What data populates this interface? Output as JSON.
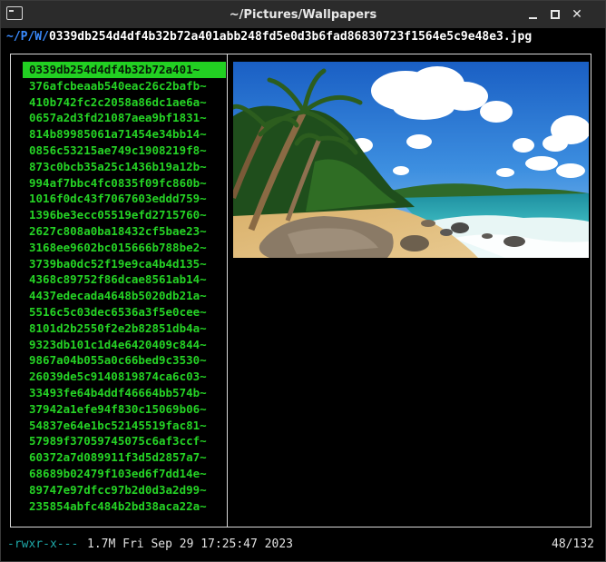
{
  "window": {
    "title": "~/Pictures/Wallpapers"
  },
  "path": {
    "dir": "~/P/W/",
    "file": "0339db254d4df4b32b72a401abb248fd5e0d3b6fad86830723f1564e5c9e48e3.jpg"
  },
  "file_list": [
    "0339db254d4df4b32b72a401~",
    "376afcbeaab540eac26c2bafb~",
    "410b742fc2c2058a86dc1ae6a~",
    "0657a2d3fd21087aea9bf1831~",
    "814b89985061a71454e34bb14~",
    "0856c53215ae749c1908219f8~",
    "873c0bcb35a25c1436b19a12b~",
    "994af7bbc4fc0835f09fc860b~",
    "1016f0dc43f7067603eddd759~",
    "1396be3ecc05519efd2715760~",
    "2627c808a0ba18432cf5bae23~",
    "3168ee9602bc015666b788be2~",
    "3739ba0dc52f19e9ca4b4d135~",
    "4368c89752f86dcae8561ab14~",
    "4437edecada4648b5020db21a~",
    "5516c5c03dec6536a3f5e0cee~",
    "8101d2b2550f2e2b82851db4a~",
    "9323db101c1d4e6420409c844~",
    "9867a04b055a0c66bed9c3530~",
    "26039de5c9140819874ca6c03~",
    "33493fe64b4ddf46664bb574b~",
    "37942a1efe94f830c15069b06~",
    "54837e64e1bc52145519fac81~",
    "57989f37059745075c6af3ccf~",
    "60372a7d089911f3d5d2857a7~",
    "68689b02479f103ed6f7dd14e~",
    "89747e97dfcc97b2d0d3a2d99~",
    "235854abfc484b2bd38aca22a~"
  ],
  "selected_index": 0,
  "status": {
    "permissions": "-rwxr-x---",
    "meta": "1.7M Fri Sep 29 17:25:47 2023",
    "position": "48/132"
  },
  "colors": {
    "list_text": "#25d325",
    "selection_bg": "#22d022",
    "path_dir": "#3a8bff",
    "permissions": "#1ea7a7"
  },
  "icons": {
    "title_icon": "terminal-icon",
    "minimize": "minimize-icon",
    "maximize": "maximize-icon",
    "close": "close-icon"
  }
}
